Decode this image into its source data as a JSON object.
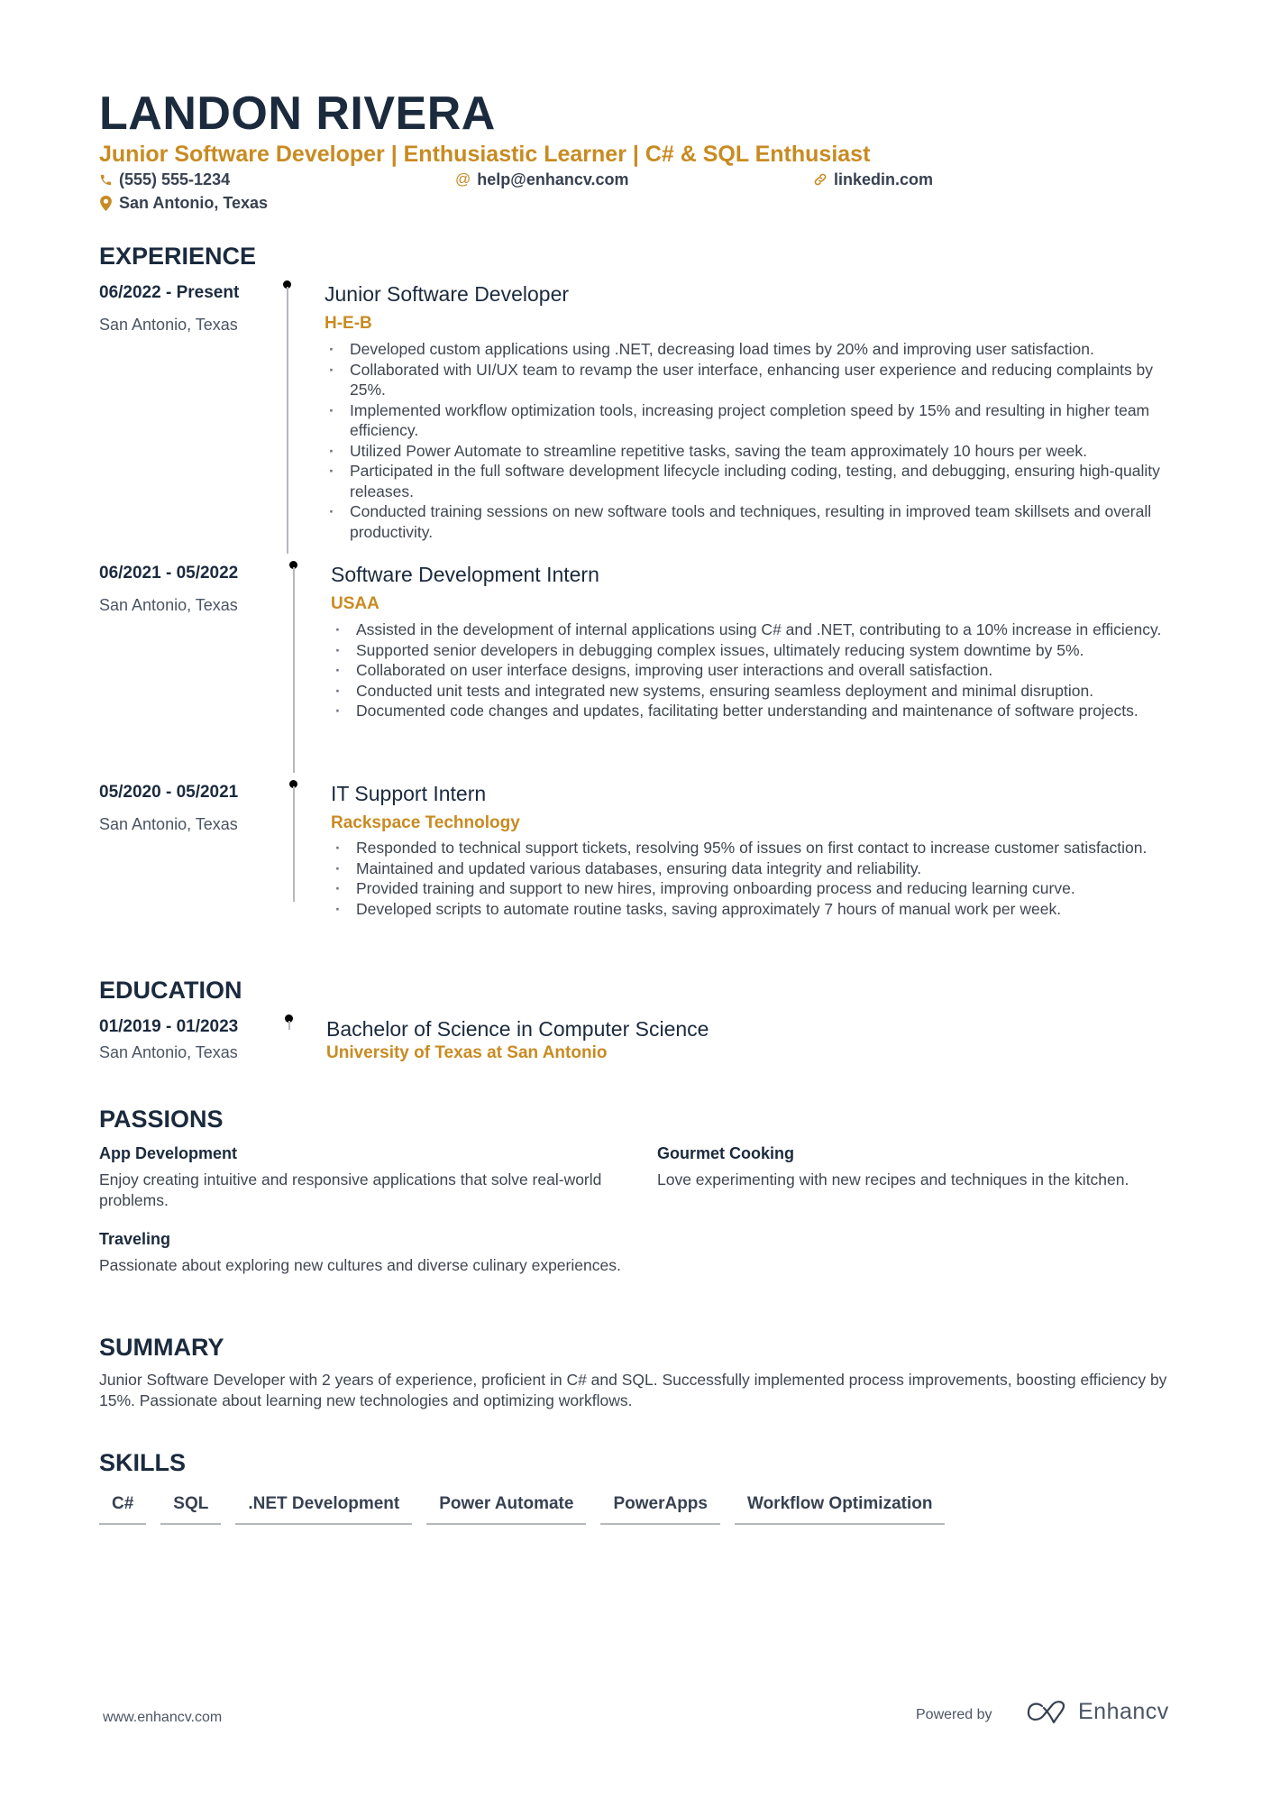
{
  "header": {
    "name": "LANDON RIVERA",
    "tagline": "Junior Software Developer | Enthusiastic Learner | C# & SQL Enthusiast",
    "phone": "(555) 555-1234",
    "email": "help@enhancv.com",
    "website": "linkedin.com",
    "location": "San Antonio, Texas"
  },
  "colors": {
    "accent": "#c88b22",
    "heading": "#1b2a3d",
    "text": "#3f4651"
  },
  "experience": {
    "title": "EXPERIENCE",
    "items": [
      {
        "dates": "06/2022 - Present",
        "location": "San Antonio, Texas",
        "role": "Junior Software Developer",
        "company": "H-E-B",
        "bullets": [
          "Developed custom applications using .NET, decreasing load times by 20% and improving user satisfaction.",
          "Collaborated with UI/UX team to revamp the user interface, enhancing user experience and reducing complaints by 25%.",
          "Implemented workflow optimization tools, increasing project completion speed by 15% and resulting in higher team efficiency.",
          "Utilized Power Automate to streamline repetitive tasks, saving the team approximately 10 hours per week.",
          "Participated in the full software development lifecycle including coding, testing, and debugging, ensuring high-quality releases.",
          "Conducted training sessions on new software tools and techniques, resulting in improved team skillsets and overall productivity."
        ]
      },
      {
        "dates": "06/2021 - 05/2022",
        "location": "San Antonio, Texas",
        "role": "Software Development Intern",
        "company": "USAA",
        "bullets": [
          "Assisted in the development of internal applications using C# and .NET, contributing to a 10% increase in efficiency.",
          "Supported senior developers in debugging complex issues, ultimately reducing system downtime by 5%.",
          "Collaborated on user interface designs, improving user interactions and overall satisfaction.",
          "Conducted unit tests and integrated new systems, ensuring seamless deployment and minimal disruption.",
          "Documented code changes and updates, facilitating better understanding and maintenance of software projects."
        ]
      },
      {
        "dates": "05/2020 - 05/2021",
        "location": "San Antonio, Texas",
        "role": "IT Support Intern",
        "company": "Rackspace Technology",
        "bullets": [
          "Responded to technical support tickets, resolving 95% of issues on first contact to increase customer satisfaction.",
          "Maintained and updated various databases, ensuring data integrity and reliability.",
          "Provided training and support to new hires, improving onboarding process and reducing learning curve.",
          "Developed scripts to automate routine tasks, saving approximately 7 hours of manual work per week."
        ]
      }
    ]
  },
  "education": {
    "title": "EDUCATION",
    "items": [
      {
        "dates": "01/2019 - 01/2023",
        "location": "San Antonio, Texas",
        "degree": "Bachelor of Science in Computer Science",
        "school": "University of Texas at San Antonio"
      }
    ]
  },
  "passions": {
    "title": "PASSIONS",
    "items": [
      {
        "title": "App Development",
        "description": "Enjoy creating intuitive and responsive applications that solve real-world problems."
      },
      {
        "title": "Gourmet Cooking",
        "description": "Love experimenting with new recipes and techniques in the kitchen."
      },
      {
        "title": "Traveling",
        "description": "Passionate about exploring new cultures and diverse culinary experiences."
      }
    ]
  },
  "summary": {
    "title": "SUMMARY",
    "text": "Junior Software Developer with 2 years of experience, proficient in C# and SQL. Successfully implemented process improvements, boosting efficiency by 15%. Passionate about learning new technologies and optimizing workflows."
  },
  "skills": {
    "title": "SKILLS",
    "items": [
      "C#",
      "SQL",
      ".NET Development",
      "Power Automate",
      "PowerApps",
      "Workflow Optimization"
    ]
  },
  "footer": {
    "url": "www.enhancv.com",
    "powered_by": "Powered by",
    "brand": "Enhancv"
  }
}
